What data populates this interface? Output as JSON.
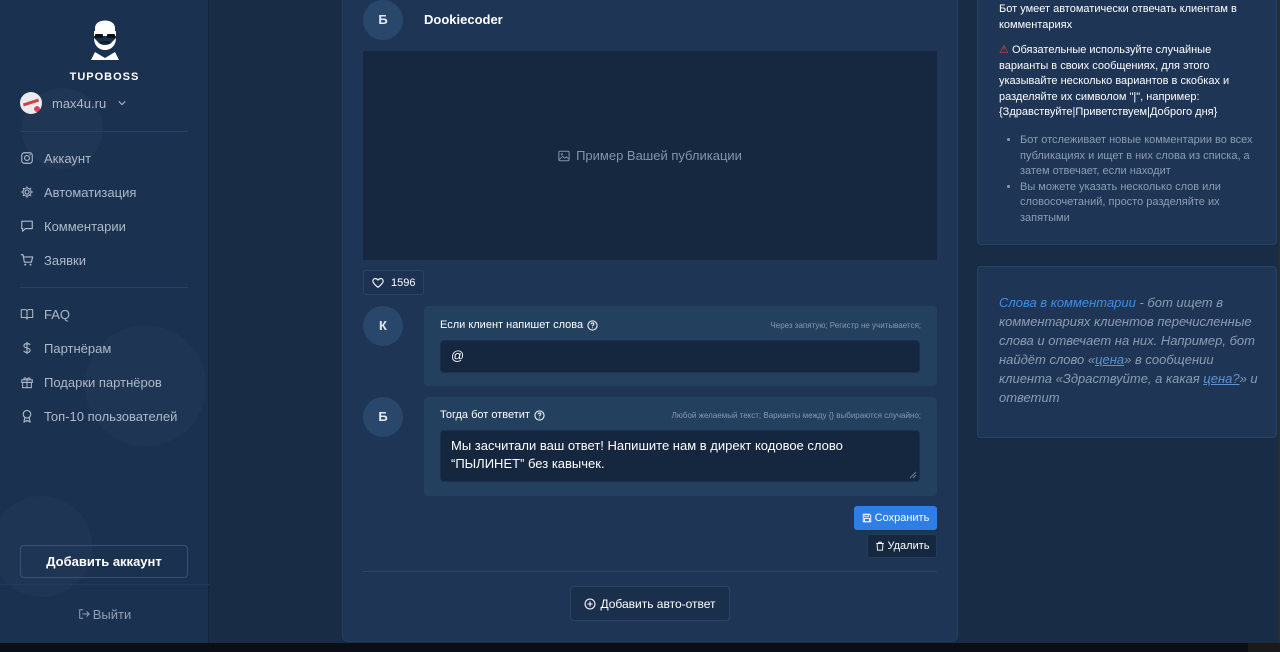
{
  "brand": {
    "name": "TUPOBOSS"
  },
  "account": {
    "name": "max4u.ru"
  },
  "sidebar": {
    "items": [
      {
        "label": "Аккаунт",
        "icon": "instagram-icon"
      },
      {
        "label": "Автоматизация",
        "icon": "gear-icon"
      },
      {
        "label": "Комментарии",
        "icon": "comment-icon"
      },
      {
        "label": "Заявки",
        "icon": "cart-icon"
      },
      {
        "label": "FAQ",
        "icon": "book-icon"
      },
      {
        "label": "Партнёрам",
        "icon": "dollar-icon"
      },
      {
        "label": "Подарки партнёров",
        "icon": "gift-icon"
      },
      {
        "label": "Топ-10 пользователей",
        "icon": "award-icon"
      }
    ],
    "add_account": "Добавить аккаунт",
    "logout": "Выйти"
  },
  "post": {
    "avatar_letter": "Б",
    "author": "Dookiecoder",
    "image_placeholder": "Пример Вашей публикации",
    "likes": "1596"
  },
  "rule": {
    "trigger": {
      "avatar_letter": "К",
      "label": "Если клиент напишет слова",
      "hint": "Через запятую; Регистр не учитывается;",
      "value": "@"
    },
    "reply": {
      "avatar_letter": "Б",
      "label": "Тогда бот ответит",
      "hint": "Любой желаемый текст; Варианты между {} выбираются случайно;",
      "value": "Мы засчитали ваш ответ! Напишите нам в директ кодовое слово “ПЫЛИНЕТ” без кавычек."
    },
    "save": "Сохранить",
    "delete": "Удалить"
  },
  "add_auto_reply": "Добавить авто-ответ",
  "info": {
    "intro": "Бот умеет автоматически отвечать клиентам в комментариях",
    "warning": "Обязательные используйте случайные варианты в своих сообщениях, для этого указывайте несколько вариантов в скобках и разделяйте их символом \"|\", например: {Здравствуйте|Приветствуем|Доброго дня}",
    "bullets": [
      "Бот отслеживает новые комментарии во всех публикациях и ищет в них слова из списка, а затем отвечает, если находит",
      "Вы можете указать несколько слов или словосочетаний, просто разделяйте их запятыми"
    ],
    "note": {
      "link": "Слова в комментарии",
      "p1": " - бот ищет в комментариях клиентов перечисленные слова и отвечает на них. Например, бот найдёт слово «",
      "w1": "цена",
      "p2": "» в сообщении клиента «Здраствуйте, а какая ",
      "w2": "цена?",
      "p3": "» и ответит"
    }
  },
  "colors": {
    "accent": "#2f7ee6",
    "warning": "#e04848",
    "link": "#3d8ee8"
  }
}
